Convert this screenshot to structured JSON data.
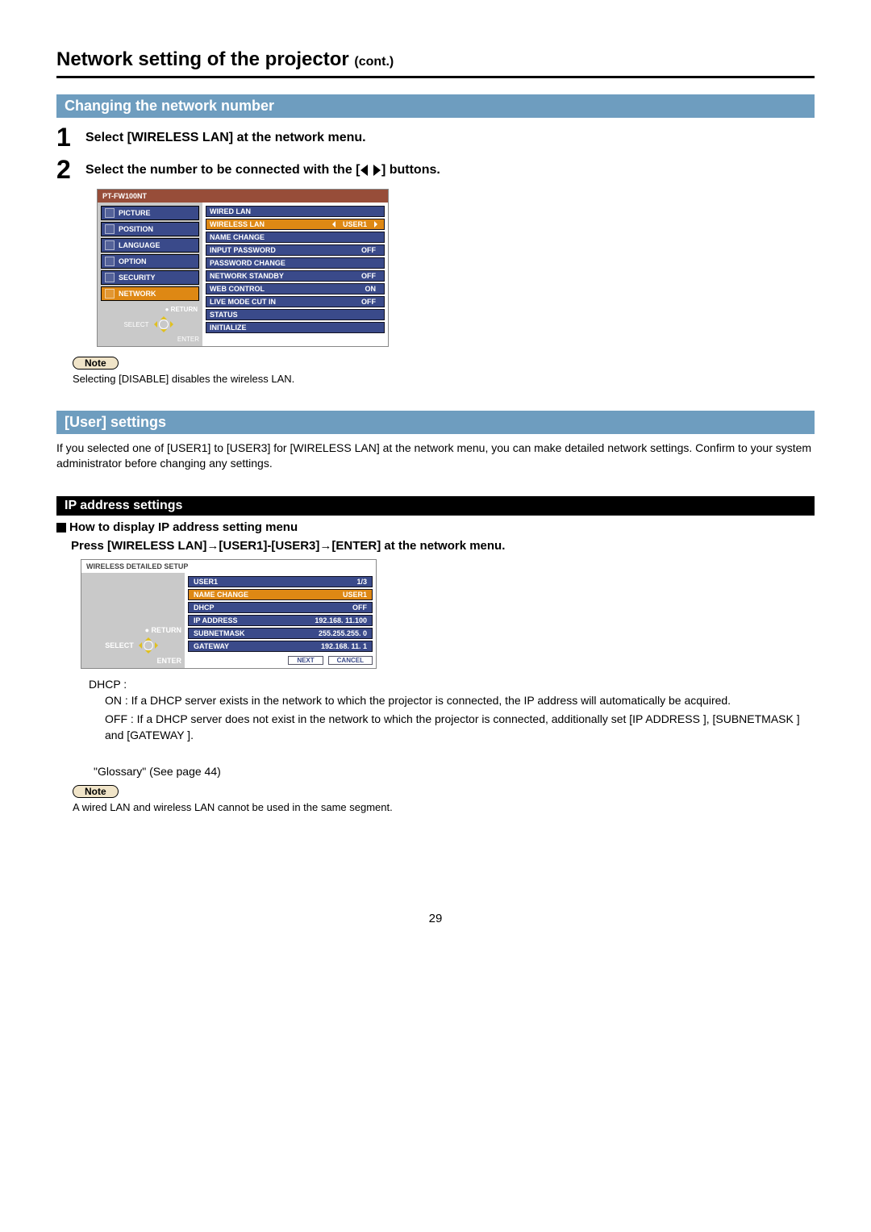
{
  "title_main": "Network setting of the projector ",
  "title_cont": "(cont.)",
  "section_changing": "Changing the network number",
  "step1_text": "Select [WIRELESS LAN] at the network menu.",
  "step2_pre": "Select the number to be connected with the [",
  "step2_post": "] buttons.",
  "note_label": "Note",
  "note1_text": "Selecting [DISABLE] disables the wireless LAN.",
  "section_user": "[User] settings",
  "user_para": "If you selected one of [USER1] to [USER3] for [WIRELESS LAN] at the network menu, you can make detailed network settings. Confirm to your system administrator before changing any settings.",
  "section_ip": "IP address settings",
  "ip_sub1": "How to display IP address setting menu",
  "ip_sub2": "Press [WIRELESS LAN]→[USER1]-[USER3]→[ENTER] at the network menu.",
  "dhcp_label": "DHCP  :",
  "dhcp_on": "ON  : If a DHCP server exists in the network to which the projector is connected, the IP address will automatically be acquired.",
  "dhcp_off": "OFF : If a DHCP server does not exist in the network to which the projector is connected, additionally set [IP ADDRESS  ], [SUBNETMASK  ] and [GATEWAY  ].",
  "glossary_ref": "\"Glossary\" (See page 44)",
  "note2_text": "A wired LAN and wireless LAN cannot be used in the same segment.",
  "page_number": "29",
  "osd1": {
    "model": "PT-FW100NT",
    "left_items": [
      "PICTURE",
      "POSITION",
      "LANGUAGE",
      "OPTION",
      "SECURITY",
      "NETWORK"
    ],
    "nav_return": "● RETURN",
    "nav_select": "SELECT",
    "nav_enter": "ENTER",
    "rows": [
      {
        "label": "WIRED LAN",
        "val": "",
        "sel": false
      },
      {
        "label": "WIRELESS LAN",
        "val": "USER1",
        "sel": true,
        "arrows": true
      },
      {
        "label": "NAME CHANGE",
        "val": "",
        "sel": false
      },
      {
        "label": "INPUT PASSWORD",
        "val": "OFF",
        "sel": false
      },
      {
        "label": "PASSWORD CHANGE",
        "val": "",
        "sel": false
      },
      {
        "label": "NETWORK STANDBY",
        "val": "OFF",
        "sel": false
      },
      {
        "label": "WEB CONTROL",
        "val": "ON",
        "sel": false
      },
      {
        "label": "LIVE MODE CUT IN",
        "val": "OFF",
        "sel": false
      },
      {
        "label": "STATUS",
        "val": "",
        "sel": false
      },
      {
        "label": "INITIALIZE",
        "val": "",
        "sel": false
      }
    ]
  },
  "osd2": {
    "title": "WIRELESS DETAILED SETUP",
    "header_label": "USER1",
    "header_page": "1/3",
    "rows": [
      {
        "label": "NAME CHANGE",
        "val": "USER1",
        "sel": true
      },
      {
        "label": "DHCP",
        "val": "OFF",
        "sel": false
      },
      {
        "label": "IP ADDRESS",
        "val": "192.168.  11.100",
        "sel": false
      },
      {
        "label": "SUBNETMASK",
        "val": "255.255.255.   0",
        "sel": false
      },
      {
        "label": "GATEWAY",
        "val": "192.168.  11.   1",
        "sel": false
      }
    ],
    "btn_next": "NEXT",
    "btn_cancel": "CANCEL",
    "nav_return": "● RETURN",
    "nav_select": "SELECT",
    "nav_enter": "ENTER"
  }
}
